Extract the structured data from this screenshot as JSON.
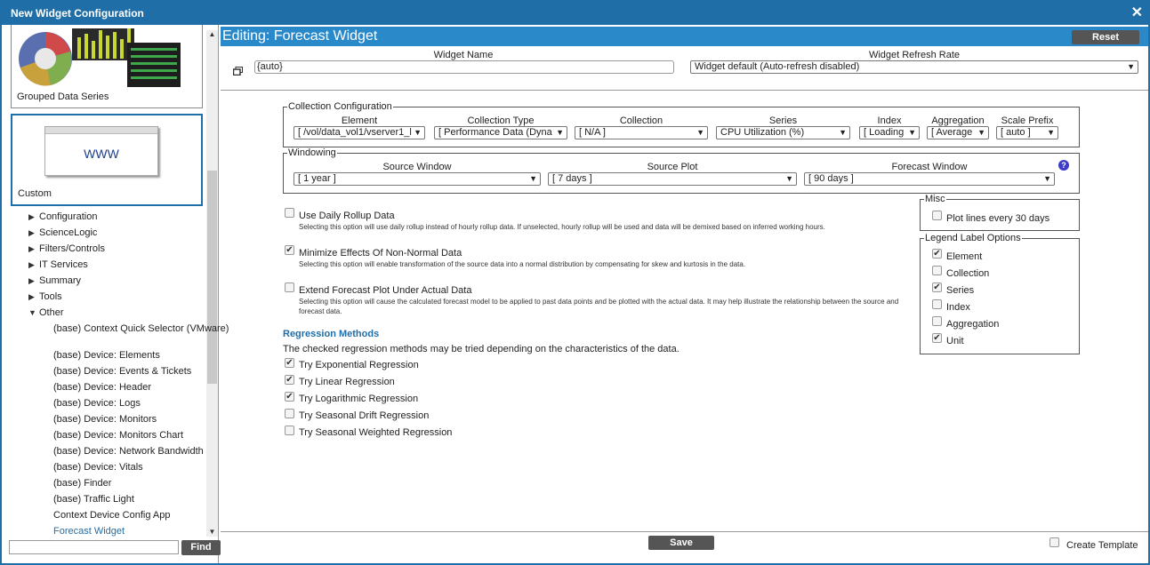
{
  "window": {
    "title": "New Widget Configuration"
  },
  "sidebar": {
    "thumbnails": [
      {
        "label": "Grouped Data Series"
      },
      {
        "label": "Custom",
        "image_text": "WWW"
      }
    ],
    "tree": [
      {
        "label": "Configuration"
      },
      {
        "label": "ScienceLogic"
      },
      {
        "label": "Filters/Controls"
      },
      {
        "label": "IT Services"
      },
      {
        "label": "Summary"
      },
      {
        "label": "Tools"
      },
      {
        "label": "Other"
      }
    ],
    "leaves": [
      "(base) Context Quick Selector (VMware)",
      "(base) Device: Elements",
      "(base) Device: Events & Tickets",
      "(base) Device: Header",
      "(base) Device: Logs",
      "(base) Device: Monitors",
      "(base) Device: Monitors Chart",
      "(base) Device: Network Bandwidth",
      "(base) Device: Vitals",
      "(base) Finder",
      "(base) Traffic Light",
      "Context Device Config App",
      "Forecast Widget"
    ],
    "find_label": "Find"
  },
  "editor": {
    "title": "Editing: Forecast Widget",
    "reset_label": "Reset",
    "widget_name_label": "Widget Name",
    "widget_name_value": "{auto}",
    "refresh_label": "Widget Refresh Rate",
    "refresh_value": "Widget default (Auto-refresh disabled)"
  },
  "collection": {
    "legend": "Collection Configuration",
    "element_label": "Element",
    "element_value": "[ /vol/data_vol1/vserver1_l",
    "ctype_label": "Collection Type",
    "ctype_value": "[ Performance Data (Dyna",
    "collection_label": "Collection",
    "collection_value": "[ N/A ]",
    "series_label": "Series",
    "series_value": "CPU Utilization (%)",
    "index_label": "Index",
    "index_value": "[ Loading",
    "aggregation_label": "Aggregation",
    "aggregation_value": "[ Average",
    "scale_label": "Scale Prefix",
    "scale_value": "[ auto ]"
  },
  "windowing": {
    "legend": "Windowing",
    "source_window_label": "Source Window",
    "source_window_value": "[ 1 year ]",
    "source_plot_label": "Source Plot",
    "source_plot_value": "[ 7 days ]",
    "forecast_window_label": "Forecast Window",
    "forecast_window_value": "[ 90 days ]"
  },
  "options": [
    {
      "label": "Use Daily Rollup Data",
      "checked": false,
      "desc": "Selecting this option will use daily rollup instead of hourly rollup data. If unselected, hourly rollup will be used and data will be demixed based on inferred working hours."
    },
    {
      "label": "Minimize Effects Of Non-Normal Data",
      "checked": true,
      "desc": "Selecting this option will enable transformation of the source data into a normal distribution by compensating for skew and kurtosis in the data."
    },
    {
      "label": "Extend Forecast Plot Under Actual Data",
      "checked": false,
      "desc": "Selecting this option will cause the calculated forecast model to be applied to past data points and be plotted with the actual data. It may help illustrate the relationship between the source and forecast data."
    }
  ],
  "regression": {
    "title": "Regression Methods",
    "desc": "The checked regression methods may be tried depending on the characteristics of the data.",
    "items": [
      {
        "label": "Try Exponential Regression",
        "checked": true
      },
      {
        "label": "Try Linear Regression",
        "checked": true
      },
      {
        "label": "Try Logarithmic Regression",
        "checked": true
      },
      {
        "label": "Try Seasonal Drift Regression",
        "checked": false
      },
      {
        "label": "Try Seasonal Weighted Regression",
        "checked": false
      }
    ]
  },
  "misc": {
    "legend": "Misc",
    "plot_lines_label": "Plot lines every 30 days",
    "plot_lines_checked": false
  },
  "legend_options": {
    "legend": "Legend Label Options",
    "items": [
      {
        "label": "Element",
        "checked": true
      },
      {
        "label": "Collection",
        "checked": false
      },
      {
        "label": "Series",
        "checked": true
      },
      {
        "label": "Index",
        "checked": false
      },
      {
        "label": "Aggregation",
        "checked": false
      },
      {
        "label": "Unit",
        "checked": true
      }
    ]
  },
  "footer": {
    "save_label": "Save",
    "create_template_label": "Create Template",
    "create_template_checked": false
  }
}
